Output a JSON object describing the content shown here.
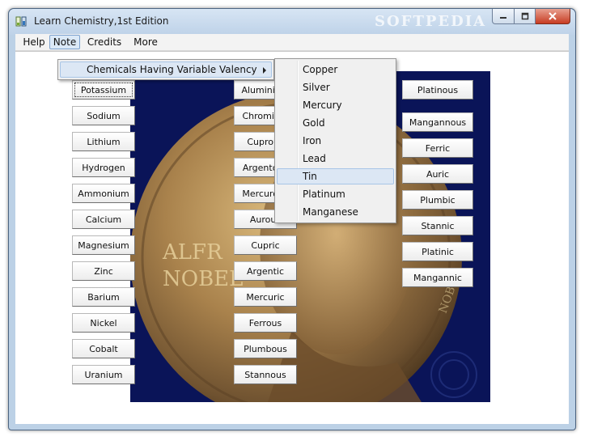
{
  "window": {
    "title": "Learn Chemistry,1st Edition",
    "watermark": "SOFTPEDIA"
  },
  "menu": {
    "help": "Help",
    "note": "Note",
    "credits": "Credits",
    "more": "More"
  },
  "note_menu": {
    "item": "Chemicals Having Variable Valency"
  },
  "submenu": [
    "Copper",
    "Silver",
    "Mercury",
    "Gold",
    "Iron",
    "Lead",
    "Tin",
    "Platinum",
    "Manganese"
  ],
  "submenu_hover_index": 6,
  "left_buttons": [
    "Potassium",
    "Sodium",
    "Lithium",
    "Hydrogen",
    "Ammonium",
    "Calcium",
    "Magnesium",
    "Zinc",
    "Barium",
    "Nickel",
    "Cobalt",
    "Uranium"
  ],
  "middle_buttons": [
    "Aluminium",
    "Chromium",
    "Cuprous",
    "Argentous",
    "Mercurous",
    "Aurous",
    "Cupric",
    "Argentic",
    "Mercuric",
    "Ferrous",
    "Plumbous",
    "Stannous"
  ],
  "right_buttons": [
    "Platinous",
    "Mangannous",
    "Ferric",
    "Auric",
    "Plumbic",
    "Stannic",
    "Platinic",
    "Mangannic"
  ],
  "medal": {
    "inscription_top": "ALFR",
    "inscription_bottom": "NOBEL",
    "side_text": "NOBEL"
  },
  "colors": {
    "medal_background": "#0a1458",
    "menu_highlight": "#dce7f4",
    "close_button": "#c73c22"
  }
}
